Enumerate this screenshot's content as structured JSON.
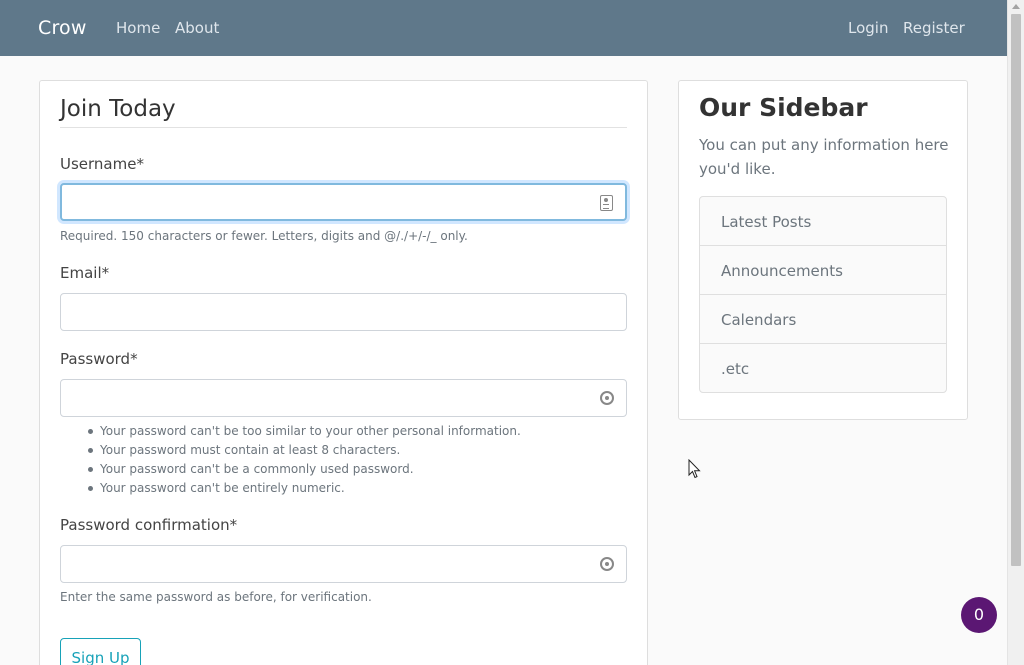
{
  "navbar": {
    "brand": "Crow",
    "links": [
      "Home",
      "About"
    ],
    "right_links": [
      "Login",
      "Register"
    ],
    "background": "#5f788a"
  },
  "form": {
    "legend": "Join Today",
    "username_label": "Username*",
    "username_help": "Required. 150 characters or fewer. Letters, digits and @/./+/-/_ only.",
    "email_label": "Email*",
    "password_label": "Password*",
    "password_rules": [
      "Your password can't be too similar to your other personal information.",
      "Your password must contain at least 8 characters.",
      "Your password can't be a commonly used password.",
      "Your password can't be entirely numeric."
    ],
    "confirm_label": "Password confirmation*",
    "confirm_help": "Enter the same password as before, for verification.",
    "submit_label": "Sign Up",
    "field_icons": [
      "contact-card-icon",
      "password-manager-icon",
      "password-manager-icon"
    ]
  },
  "sidebar": {
    "title": "Our Sidebar",
    "lead": "You can put any information here you'd like.",
    "items": [
      "Latest Posts",
      "Announcements",
      "Calendars",
      ".etc"
    ]
  },
  "badge": {
    "count": "0",
    "color": "#5b1773"
  },
  "accent_color": "#17a2b8"
}
